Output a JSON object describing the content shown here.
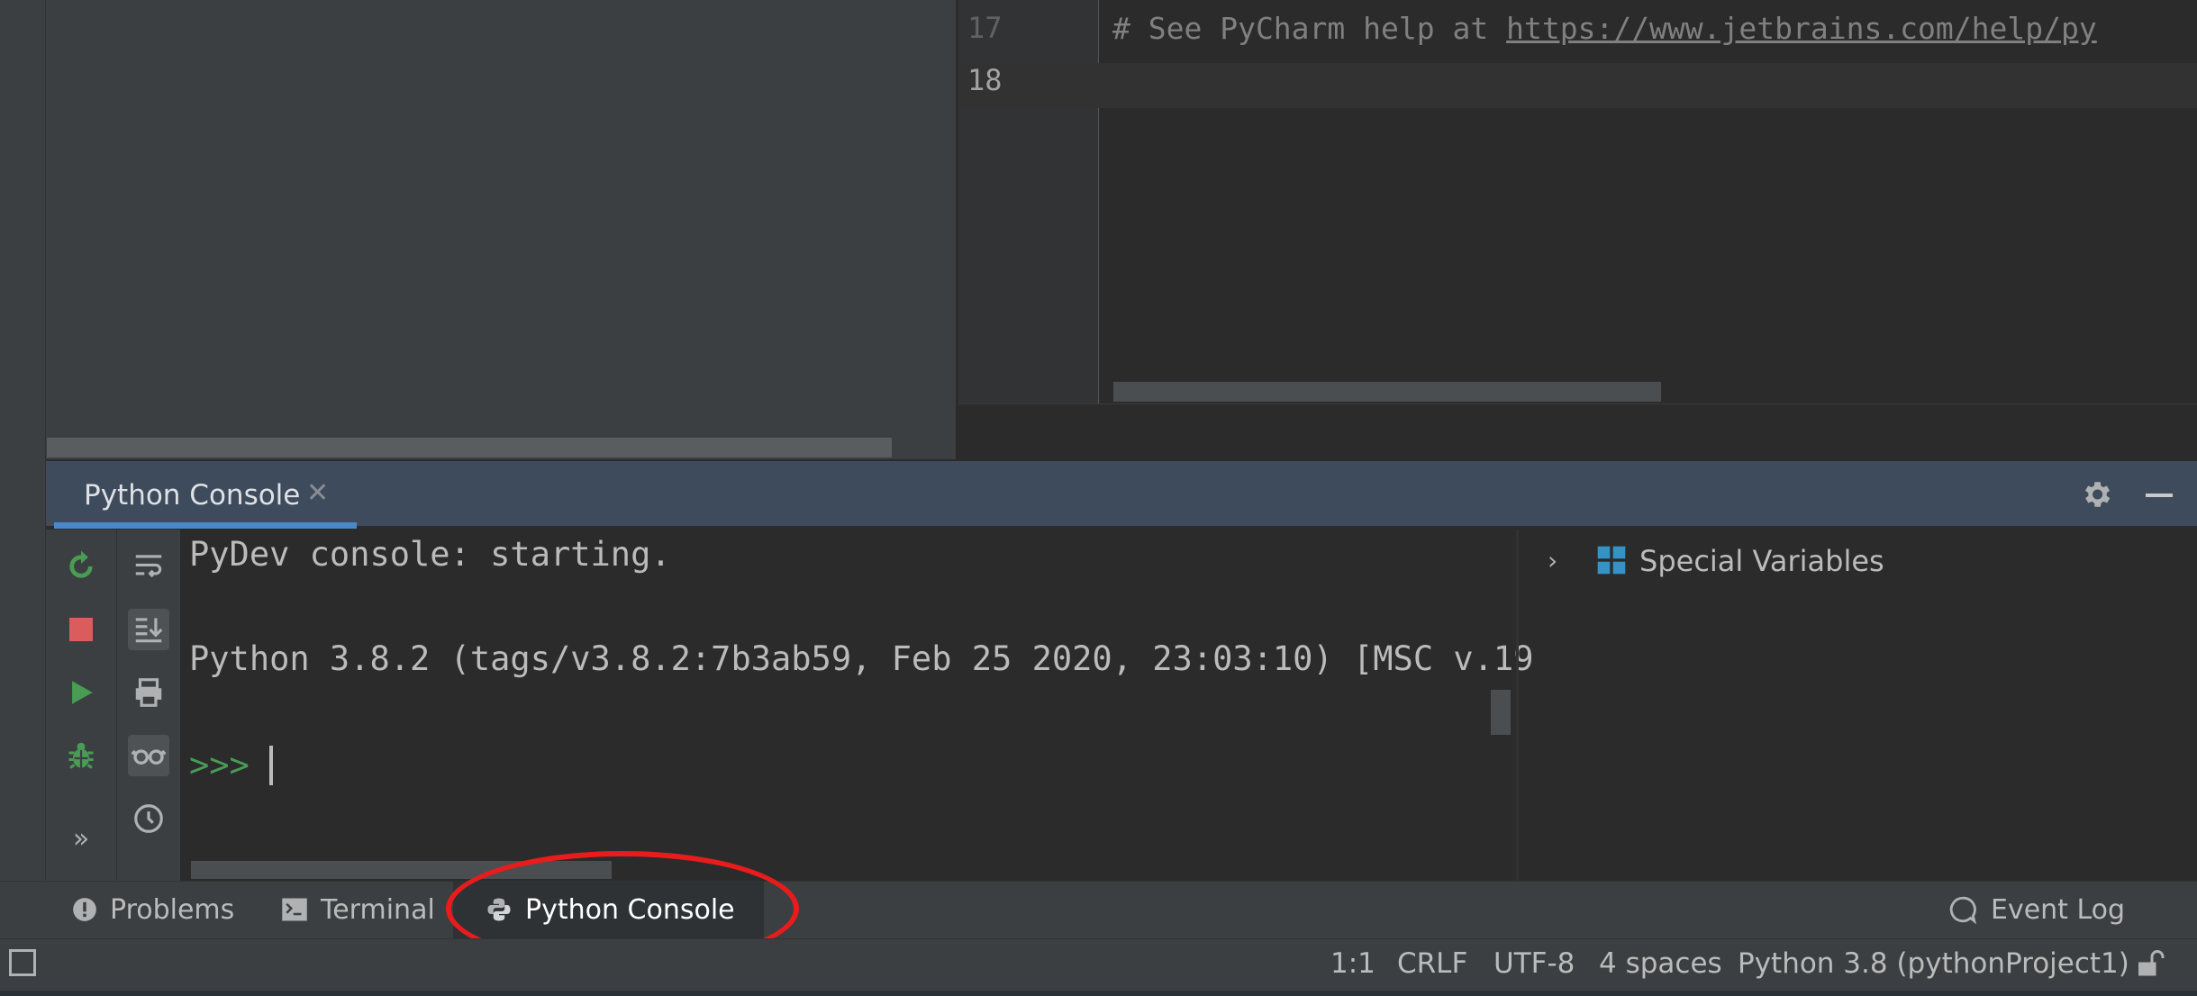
{
  "editor": {
    "line_numbers": [
      "17",
      "18"
    ],
    "comment_prefix": "# See PyCharm help at ",
    "comment_link": "https://www.jetbrains.com/help/py"
  },
  "tool_window": {
    "tab_label": "Python Console",
    "close_glyph": "✕",
    "settings_icon": "gear-icon",
    "minimize_icon": "minimize-icon"
  },
  "console": {
    "lines": [
      "PyDev console: starting.",
      "Python 3.8.2 (tags/v3.8.2:7b3ab59, Feb 25 2020, 23:03:10) [MSC v.19"
    ],
    "prompt": ">>>",
    "toolbar_left": [
      "rerun-icon",
      "stop-icon",
      "run-icon",
      "debug-icon",
      "more-icon"
    ],
    "toolbar_right": [
      "soft-wrap-icon",
      "scroll-to-end-icon",
      "print-icon",
      "show-variables-icon",
      "history-icon"
    ],
    "more_glyph": "»"
  },
  "variables": {
    "chevron": "›",
    "label": "Special Variables"
  },
  "tool_strip": {
    "problems": "Problems",
    "terminal": "Terminal",
    "python_console": "Python Console",
    "event_log": "Event Log"
  },
  "status_bar": {
    "position": "1:1",
    "line_separator": "CRLF",
    "encoding": "UTF-8",
    "indent": "4 spaces",
    "interpreter": "Python 3.8 (pythonProject1)"
  },
  "colors": {
    "accent": "#4a88c7",
    "highlight_circle": "#e81c1c",
    "prompt_green": "#499c54",
    "stop_red": "#db5c5c"
  }
}
